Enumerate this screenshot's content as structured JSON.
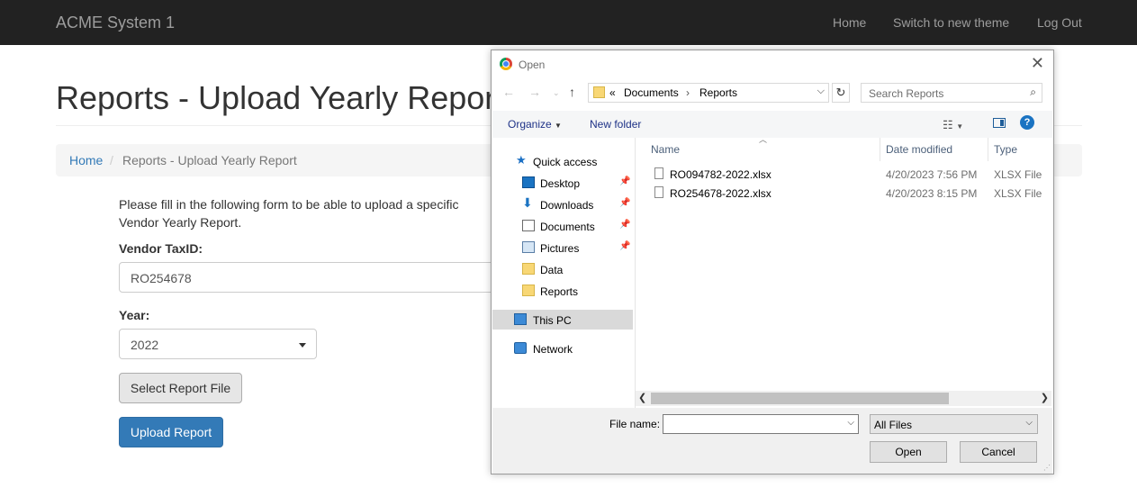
{
  "navbar": {
    "brand": "ACME System 1",
    "links": [
      "Home",
      "Switch to new theme",
      "Log Out"
    ]
  },
  "page": {
    "title": "Reports - Upload Yearly Report",
    "breadcrumb": {
      "home": "Home",
      "separator": "/",
      "current": "Reports - Upload Yearly Report"
    },
    "intro": "Please fill in the following form to be able to upload a specific Vendor Yearly Report.",
    "vendor_label": "Vendor TaxID:",
    "vendor_value": "RO254678",
    "year_label": "Year:",
    "year_value": "2022",
    "select_file_label": "Select Report File",
    "upload_label": "Upload Report",
    "colors": {
      "navbar_bg": "#222222",
      "primary": "#337ab7"
    }
  },
  "dialog": {
    "title": "Open",
    "path": {
      "prefix": "«",
      "parts": [
        "Documents",
        "Reports"
      ],
      "separator": "›"
    },
    "search_placeholder": "Search Reports",
    "toolbar": {
      "organize": "Organize",
      "new_folder": "New folder"
    },
    "nav_items": [
      {
        "label": "Quick access",
        "icon": "star-icon"
      },
      {
        "label": "Desktop",
        "icon": "desktop-icon",
        "pinned": true
      },
      {
        "label": "Downloads",
        "icon": "download-icon",
        "pinned": true
      },
      {
        "label": "Documents",
        "icon": "document-icon",
        "pinned": true
      },
      {
        "label": "Pictures",
        "icon": "picture-icon",
        "pinned": true
      },
      {
        "label": "Data",
        "icon": "folder-icon"
      },
      {
        "label": "Reports",
        "icon": "folder-icon"
      },
      {
        "label": "This PC",
        "icon": "computer-icon",
        "selected": true
      },
      {
        "label": "Network",
        "icon": "network-icon"
      }
    ],
    "columns": [
      "Name",
      "Date modified",
      "Type"
    ],
    "files": [
      {
        "name": "RO094782-2022.xlsx",
        "date": "4/20/2023 7:56 PM",
        "type": "XLSX File"
      },
      {
        "name": "RO254678-2022.xlsx",
        "date": "4/20/2023 8:15 PM",
        "type": "XLSX File"
      }
    ],
    "file_name_label": "File name:",
    "file_name_value": "",
    "filter_value": "All Files",
    "open_label": "Open",
    "cancel_label": "Cancel"
  }
}
